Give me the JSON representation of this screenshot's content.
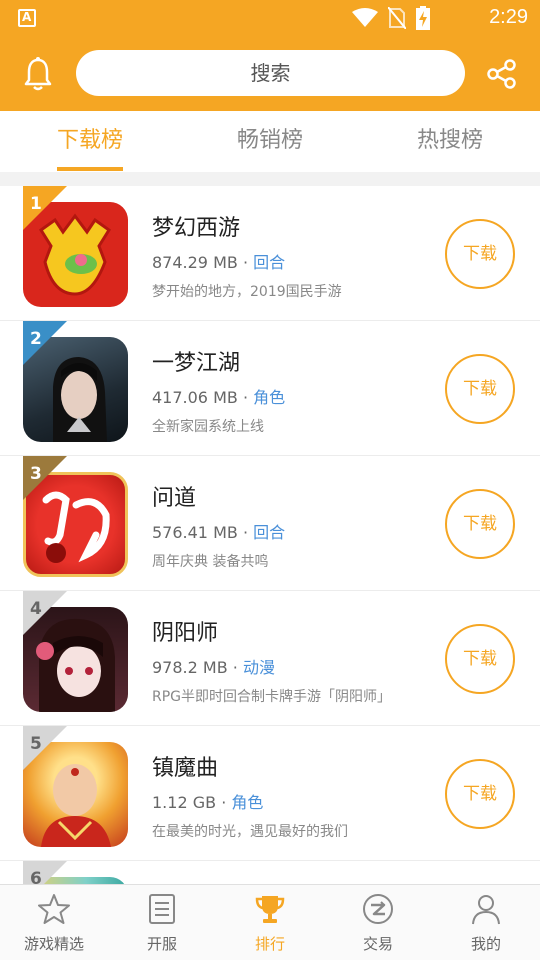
{
  "status_bar": {
    "time": "2:29",
    "app_badge": "A"
  },
  "header": {
    "search_label": "搜索"
  },
  "tabs": [
    {
      "label": "下载榜",
      "active": true
    },
    {
      "label": "畅销榜",
      "active": false
    },
    {
      "label": "热搜榜",
      "active": false
    }
  ],
  "apps": [
    {
      "rank": "1",
      "name": "梦幻西游",
      "size": "874.29 MB",
      "category": "回合",
      "desc": "梦开始的地方，2019国民手游",
      "button": "下载",
      "rank_color": "#f5a623"
    },
    {
      "rank": "2",
      "name": "一梦江湖",
      "size": "417.06 MB",
      "category": "角色",
      "desc": "全新家园系统上线",
      "button": "下载",
      "rank_color": "#3a8fc7"
    },
    {
      "rank": "3",
      "name": "问道",
      "size": "576.41 MB",
      "category": "回合",
      "desc": "周年庆典 装备共鸣",
      "button": "下载",
      "rank_color": "#9c7a3c"
    },
    {
      "rank": "4",
      "name": "阴阳师",
      "size": "978.2 MB",
      "category": "动漫",
      "desc": "RPG半即时回合制卡牌手游「阴阳师」",
      "button": "下载",
      "rank_color": "#c8c8c8"
    },
    {
      "rank": "5",
      "name": "镇魔曲",
      "size": "1.12 GB",
      "category": "角色",
      "desc": "在最美的时光，遇见最好的我们",
      "button": "下载",
      "rank_color": "#c8c8c8"
    },
    {
      "rank": "6"
    }
  ],
  "separator": "·",
  "bottom_nav": [
    {
      "label": "游戏精选",
      "icon": "star-icon",
      "active": false
    },
    {
      "label": "开服",
      "icon": "list-icon",
      "active": false
    },
    {
      "label": "排行",
      "icon": "trophy-icon",
      "active": true
    },
    {
      "label": "交易",
      "icon": "exchange-icon",
      "active": false
    },
    {
      "label": "我的",
      "icon": "person-icon",
      "active": false
    }
  ],
  "colors": {
    "accent": "#f5a623",
    "category": "#4a90d9"
  }
}
